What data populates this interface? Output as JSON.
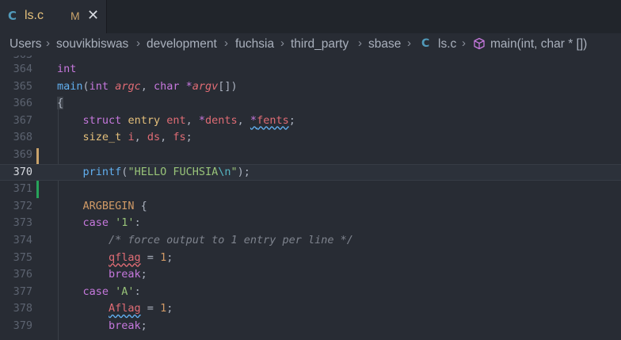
{
  "tab": {
    "lang_icon": "C",
    "name": "ls.c",
    "modified": "M",
    "close": "✕"
  },
  "breadcrumb": {
    "items": [
      "Users",
      "souvikbiswas",
      "development",
      "fuchsia",
      "third_party",
      "sbase"
    ],
    "separator": "›",
    "file_icon": "C",
    "file": "ls.c",
    "symbol_icon": "cube-icon",
    "symbol": "main(int, char * [])"
  },
  "editor": {
    "lines": {
      "l364": {
        "num": "364",
        "t1": "int"
      },
      "l365": {
        "num": "365",
        "t1": "main",
        "t2": "(",
        "t3": "int",
        "t4": "argc",
        "t5": ", ",
        "t6": "char",
        "t7": "*",
        "t8": "argv",
        "t9": "[])"
      },
      "l366": {
        "num": "366",
        "t1": "{"
      },
      "l367": {
        "num": "367",
        "t1": "struct",
        "t2": "entry",
        "t3": "ent",
        "t4": ", ",
        "t5": "*",
        "t6": "dents",
        "t7": ", ",
        "t8": "*",
        "t9": "fents",
        "t10": ";"
      },
      "l368": {
        "num": "368",
        "t1": "size_t",
        "t2": "i",
        "t3": ", ",
        "t4": "ds",
        "t5": ", ",
        "t6": "fs",
        "t7": ";"
      },
      "l369": {
        "num": "369"
      },
      "l370": {
        "num": "370",
        "t1": "printf",
        "t2": "(",
        "t3": "\"HELLO FUCHSIA",
        "t4": "\\n",
        "t5": "\"",
        "t6": ");"
      },
      "l371": {
        "num": "371"
      },
      "l372": {
        "num": "372",
        "t1": "ARGBEGIN",
        "t2": " {"
      },
      "l373": {
        "num": "373",
        "t1": "case",
        "t2": "'1'",
        "t3": ":"
      },
      "l374": {
        "num": "374",
        "t1": "/* force output to 1 entry per line */"
      },
      "l375": {
        "num": "375",
        "t1": "qflag",
        "t2": " = ",
        "t3": "1",
        "t4": ";"
      },
      "l376": {
        "num": "376",
        "t1": "break",
        "t2": ";"
      },
      "l377": {
        "num": "377",
        "t1": "case",
        "t2": "'A'",
        "t3": ":"
      },
      "l378": {
        "num": "378",
        "t1": "Aflag",
        "t2": " = ",
        "t3": "1",
        "t4": ";"
      },
      "l379": {
        "num": "379",
        "t1": "break",
        "t2": ";"
      }
    }
  },
  "colors": {
    "background": "#282c34",
    "git_modified": "#e5c07b",
    "git_added": "#98c379"
  }
}
